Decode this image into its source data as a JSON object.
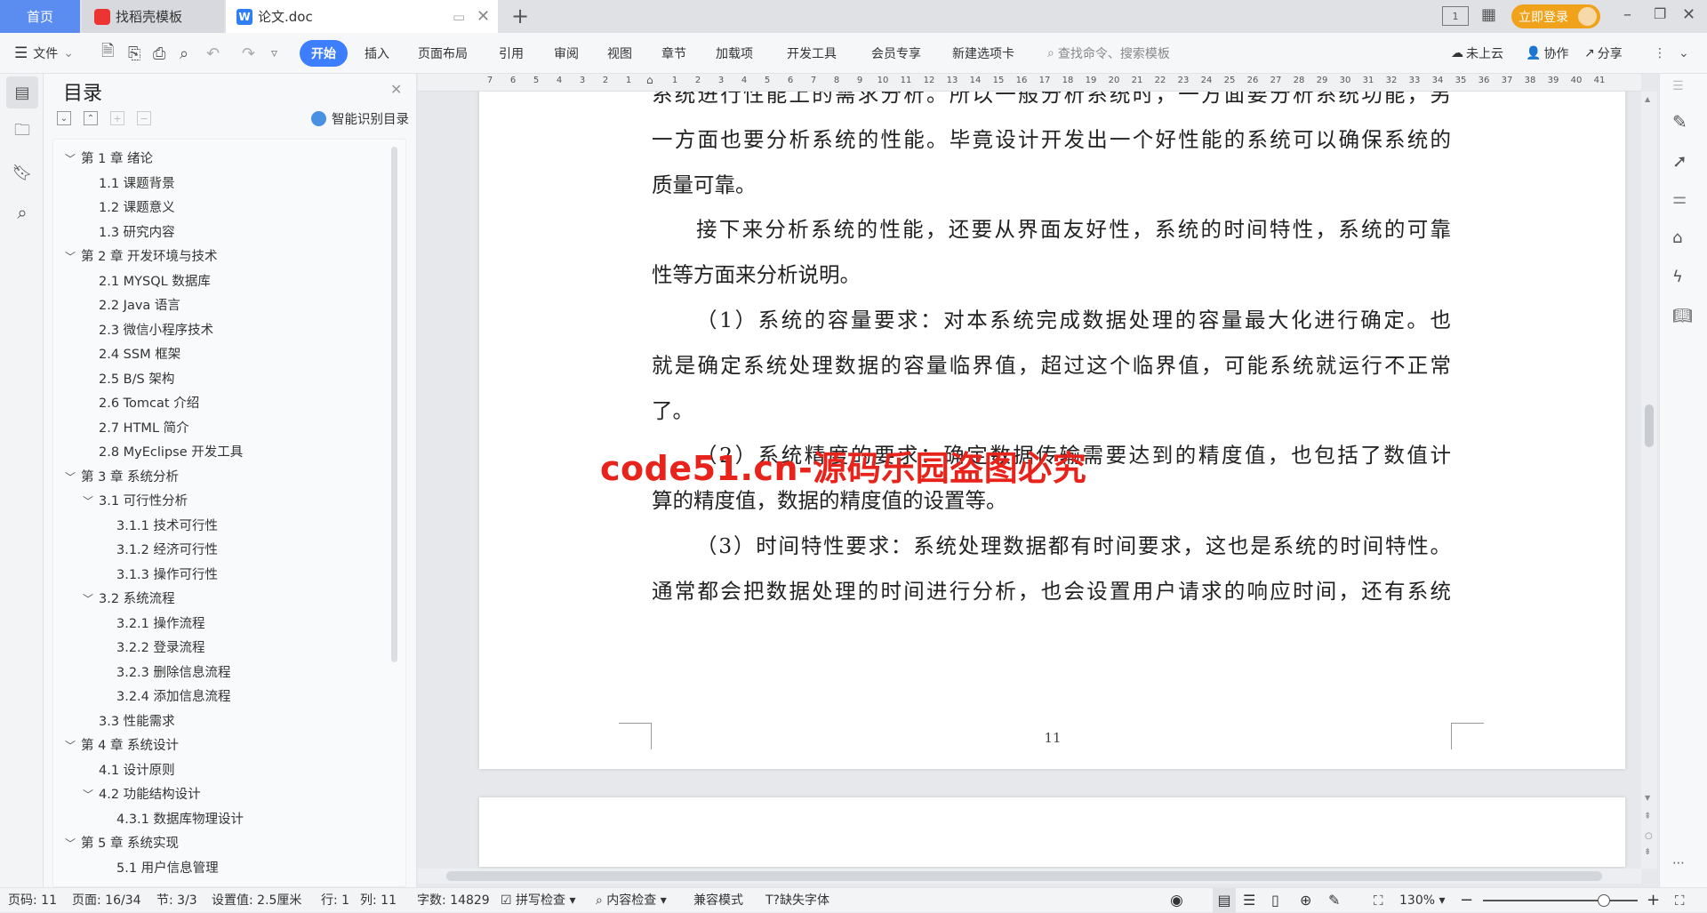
{
  "tabs": [
    {
      "label": "首页",
      "active": false
    },
    {
      "label": "找稻壳模板"
    },
    {
      "label": "论文.doc",
      "active": true
    }
  ],
  "window": {
    "login": "立即登录"
  },
  "menu": {
    "file": "文件",
    "ribbon": [
      "开始",
      "插入",
      "页面布局",
      "引用",
      "审阅",
      "视图",
      "章节",
      "加载项",
      "开发工具",
      "会员专享",
      "新建选项卡"
    ],
    "search_placeholder": "查找命令、搜索模板",
    "cloud": "未上云",
    "collab": "协作",
    "share": "分享"
  },
  "sidebar": {
    "title": "目录",
    "smart": "智能识别目录",
    "items": [
      {
        "label": "第 1 章  绪论",
        "level": 0,
        "chev": true
      },
      {
        "label": "1.1  课题背景",
        "level": 1
      },
      {
        "label": "1.2  课题意义",
        "level": 1
      },
      {
        "label": "1.3  研究内容",
        "level": 1
      },
      {
        "label": "第 2 章  开发环境与技术",
        "level": 0,
        "chev": true
      },
      {
        "label": "2.1 MYSQL 数据库",
        "level": 1
      },
      {
        "label": "2.2 Java 语言",
        "level": 1
      },
      {
        "label": "2.3  微信小程序技术",
        "level": 1
      },
      {
        "label": "2.4 SSM 框架",
        "level": 1
      },
      {
        "label": "2.5 B/S 架构",
        "level": 1
      },
      {
        "label": "2.6 Tomcat  介绍",
        "level": 1
      },
      {
        "label": "2.7 HTML 简介",
        "level": 1
      },
      {
        "label": "2.8 MyEclipse 开发工具",
        "level": 1
      },
      {
        "label": "第 3 章  系统分析",
        "level": 0,
        "chev": true
      },
      {
        "label": "3.1  可行性分析",
        "level": 1,
        "chev": true
      },
      {
        "label": "3.1.1  技术可行性",
        "level": 2
      },
      {
        "label": "3.1.2  经济可行性",
        "level": 2
      },
      {
        "label": "3.1.3  操作可行性",
        "level": 2
      },
      {
        "label": "3.2  系统流程",
        "level": 1,
        "chev": true
      },
      {
        "label": "3.2.1  操作流程",
        "level": 2
      },
      {
        "label": "3.2.2  登录流程",
        "level": 2
      },
      {
        "label": "3.2.3  删除信息流程",
        "level": 2
      },
      {
        "label": "3.2.4  添加信息流程",
        "level": 2
      },
      {
        "label": "3.3  性能需求",
        "level": 1
      },
      {
        "label": "第 4 章  系统设计",
        "level": 0,
        "chev": true
      },
      {
        "label": "4.1  设计原则",
        "level": 1
      },
      {
        "label": "4.2  功能结构设计",
        "level": 1,
        "chev": true
      },
      {
        "label": "4.3.1  数据库物理设计",
        "level": 2
      },
      {
        "label": "第 5 章  系统实现",
        "level": 0,
        "chev": true
      },
      {
        "label": "5.1 用户信息管理",
        "level": 2
      }
    ]
  },
  "ruler": {
    "left": [
      "7",
      "6",
      "5",
      "4",
      "3",
      "2",
      "1"
    ],
    "right": [
      "1",
      "2",
      "3",
      "4",
      "5",
      "6",
      "7",
      "8",
      "9",
      "10",
      "11",
      "12",
      "13",
      "14",
      "15",
      "16",
      "17",
      "18",
      "19",
      "20",
      "21",
      "22",
      "23",
      "24",
      "25",
      "26",
      "27",
      "28",
      "29",
      "30",
      "31",
      "32",
      "33",
      "34",
      "35",
      "36",
      "37",
      "38",
      "39",
      "40",
      "41"
    ]
  },
  "document": {
    "lines": [
      {
        "text": "系统进行性能上的需求分析。所以一般分析系统时，一方面要分析系统功能，另",
        "full": true
      },
      {
        "text": "一方面也要分析系统的性能。毕竟设计开发出一个好性能的系统可以确保系统的",
        "full": true
      },
      {
        "text": "质量可靠。"
      },
      {
        "text": "接下来分析系统的性能，还要从界面友好性，系统的时间特性，系统的可靠",
        "full": true,
        "indent": true
      },
      {
        "text": "性等方面来分析说明。"
      },
      {
        "text": "（1）系统的容量要求：对本系统完成数据处理的容量最大化进行确定。也",
        "full": true,
        "indent": true
      },
      {
        "text": "就是确定系统处理数据的容量临界值，超过这个临界值，可能系统就运行不正常",
        "full": true
      },
      {
        "text": "了。"
      },
      {
        "text": "（2）系统精度的要求：确定数据传输需要达到的精度值，也包括了数值计",
        "full": true,
        "indent": true
      },
      {
        "text": "算的精度值，数据的精度值的设置等。"
      },
      {
        "text": "（3）时间特性要求：系统处理数据都有时间要求，这也是系统的时间特性。",
        "full": true,
        "indent": true
      },
      {
        "text": "通常都会把数据处理的时间进行分析，也会设置用户请求的响应时间，还有系统",
        "full": true
      }
    ],
    "page_number": "11",
    "watermark": "code51.cn-源码乐园盗图必究"
  },
  "status": {
    "page_no": "页码: 11",
    "pages": "页面: 16/34",
    "section": "节: 3/3",
    "setting": "设置值: 2.5厘米",
    "row": "行: 1",
    "col": "列: 11",
    "words": "字数: 14829",
    "spell": "拼写检查",
    "content": "内容检查",
    "compat": "兼容模式",
    "missing_font": "缺失字体",
    "zoom": "130%",
    "zoom_percent": 130
  },
  "colors": {
    "accent": "#3d7eff",
    "login": "#f0a21b",
    "watermark": "#e8231b"
  }
}
